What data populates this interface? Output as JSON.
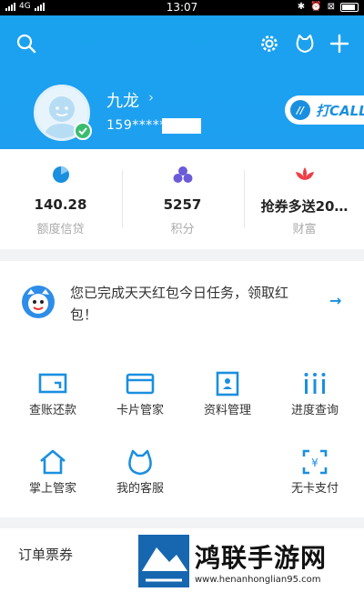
{
  "statusbar": {
    "carrier": "4G",
    "time": "13:07"
  },
  "header": {
    "username": "九龙",
    "phone": "159*****",
    "call_label": "打CALL"
  },
  "stats": [
    {
      "value": "140.28",
      "label": "额度信贷"
    },
    {
      "value": "5257",
      "label": "积分"
    },
    {
      "value": "抢券多送20…",
      "label": "财富"
    }
  ],
  "notice": {
    "text": "您已完成天天红包今日任务，领取红包！",
    "arrow": "→"
  },
  "grid": [
    {
      "label": "查账还款",
      "icon": "bill-icon"
    },
    {
      "label": "卡片管家",
      "icon": "card-icon"
    },
    {
      "label": "资料管理",
      "icon": "profile-icon"
    },
    {
      "label": "进度查询",
      "icon": "progress-icon"
    },
    {
      "label": "掌上管家",
      "icon": "home-icon"
    },
    {
      "label": "我的客服",
      "icon": "service-icon"
    },
    {
      "label": "无卡支付",
      "icon": "scan-pay-icon"
    }
  ],
  "bottom": {
    "title": "订单票券"
  },
  "watermark": {
    "title": "鸿联手游网",
    "url": "www.henanhonglian95.com"
  },
  "colors": {
    "brand_blue": "#1aa2ef",
    "accent_blue": "#1a8fe0",
    "badge_green": "#3bbd6e"
  }
}
